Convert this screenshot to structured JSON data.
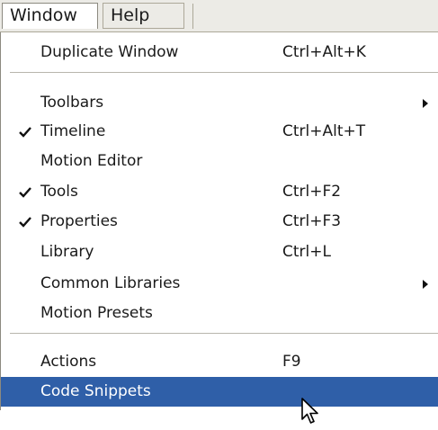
{
  "menubar": {
    "window": "Window",
    "help": "Help"
  },
  "menu": {
    "items": [
      {
        "label": "Duplicate Window",
        "shortcut": "Ctrl+Alt+K"
      },
      {
        "label": "Toolbars",
        "shortcut": "",
        "submenu": true
      },
      {
        "label": "Timeline",
        "shortcut": "Ctrl+Alt+T",
        "checked": true
      },
      {
        "label": "Motion Editor",
        "shortcut": ""
      },
      {
        "label": "Tools",
        "shortcut": "Ctrl+F2",
        "checked": true
      },
      {
        "label": "Properties",
        "shortcut": "Ctrl+F3",
        "checked": true
      },
      {
        "label": "Library",
        "shortcut": "Ctrl+L"
      },
      {
        "label": "Common Libraries",
        "shortcut": "",
        "submenu": true
      },
      {
        "label": "Motion Presets",
        "shortcut": ""
      },
      {
        "label": "Actions",
        "shortcut": "F9"
      },
      {
        "label": "Code Snippets",
        "shortcut": "",
        "selected": true
      }
    ]
  },
  "colors": {
    "highlight": "#2f5fa8",
    "menubar_bg": "#ecebe6"
  },
  "icons": {
    "check": "checkmark-icon",
    "submenu": "submenu-arrow-icon",
    "cursor": "mouse-pointer-icon"
  }
}
